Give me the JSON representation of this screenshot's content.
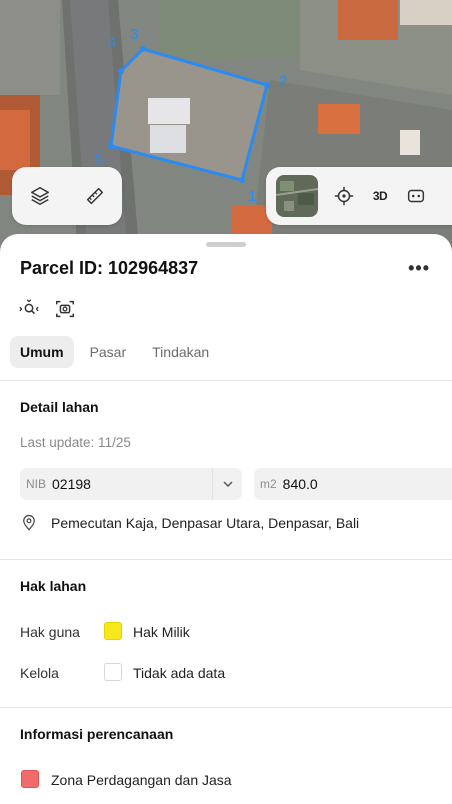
{
  "map": {
    "vertex_labels": [
      "4",
      "3",
      "2",
      "1",
      "5"
    ],
    "toolbar_left": {
      "icons": [
        "layers-icon",
        "ruler-icon"
      ]
    },
    "toolbar_right": {
      "three_d_label": "3D",
      "icons": [
        "satellite-thumbnail",
        "locate-icon",
        "robot-icon"
      ]
    },
    "accent_color": "#2a8cf0"
  },
  "parcel": {
    "title": "Parcel ID: 102964837",
    "more_label": "•••"
  },
  "tabs": [
    {
      "label": "Umum",
      "active": true
    },
    {
      "label": "Pasar",
      "active": false
    },
    {
      "label": "Tindakan",
      "active": false
    }
  ],
  "detail": {
    "heading": "Detail lahan",
    "last_update": "Last update: 11/25",
    "nib_prefix": "NIB",
    "nib_value": "02198",
    "area_prefix": "m2",
    "area_value": "840.0",
    "address": "Pemecutan Kaja, Denpasar Utara, Denpasar, Bali"
  },
  "rights": {
    "heading": "Hak lahan",
    "rows": [
      {
        "label": "Hak guna",
        "value": "Hak Milik",
        "swatch_color": "#f7e81c"
      },
      {
        "label": "Kelola",
        "value": "Tidak ada data",
        "swatch_color": "#ffffff"
      }
    ]
  },
  "planning": {
    "heading": "Informasi perencanaan",
    "zone": "Zona Perdagangan dan Jasa",
    "zone_color": "#f26b6b"
  }
}
